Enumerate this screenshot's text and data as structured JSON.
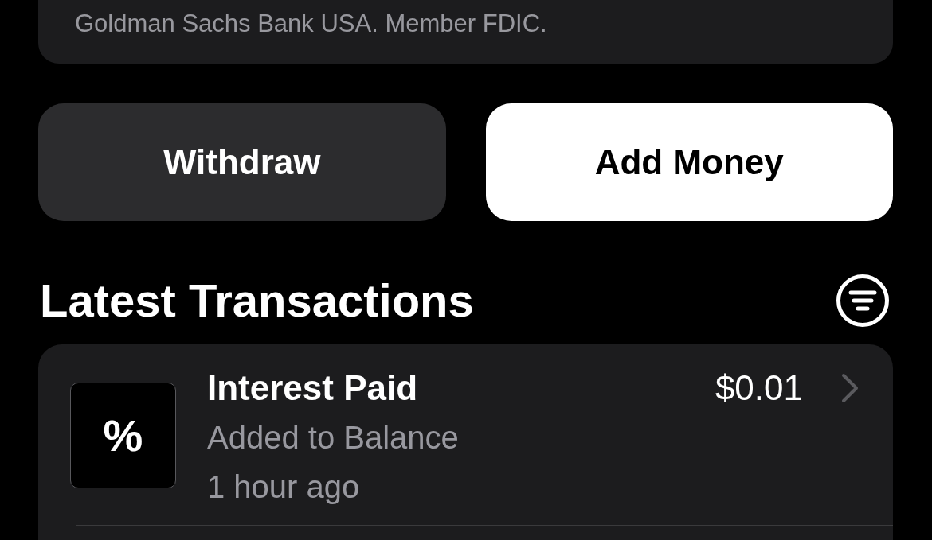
{
  "disclosure": {
    "text": "Goldman Sachs Bank USA. Member FDIC."
  },
  "actions": [
    {
      "label": "Withdraw",
      "kind": "secondary"
    },
    {
      "label": "Add Money",
      "kind": "primary"
    }
  ],
  "transactions_section": {
    "title": "Latest Transactions"
  },
  "transactions": [
    {
      "icon_symbol": "%",
      "title": "Interest Paid",
      "subtitle": "Added to Balance",
      "time": "1 hour ago",
      "amount": "$0.01"
    }
  ]
}
